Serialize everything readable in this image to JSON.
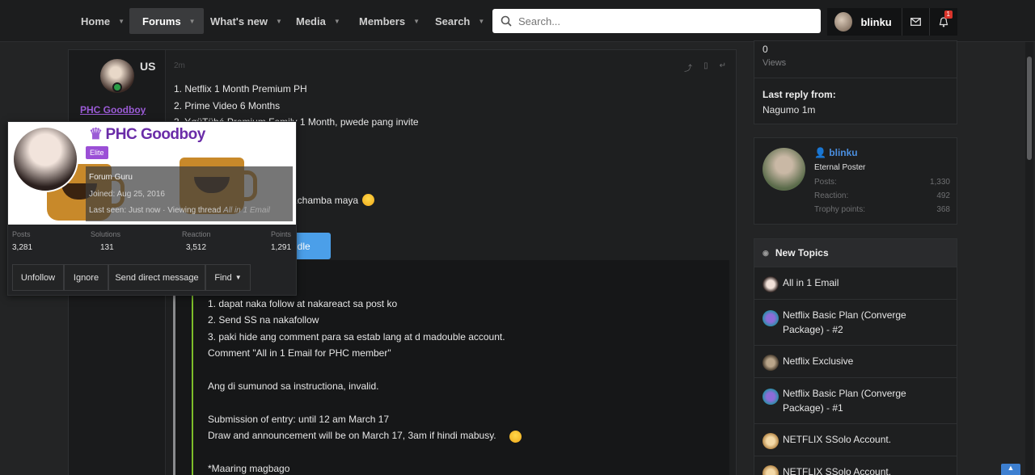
{
  "nav": {
    "items": [
      {
        "label": "Home"
      },
      {
        "label": "Forums"
      },
      {
        "label": "What's new"
      },
      {
        "label": "Media"
      },
      {
        "label": "Members"
      },
      {
        "label": "Search"
      }
    ],
    "search_placeholder": "Search...",
    "username": "blinku",
    "alert_count": "1"
  },
  "post": {
    "us_label": "US",
    "username": "PHC Goodboy",
    "time": "2m",
    "lines": [
      "1. Netflix 1 Month Premium PH",
      "2. Prime Video 6 Months",
      "3. YøüTübé Premium Family 1 Month, pwede pang invite"
    ],
    "partial_line": "kachamba maya",
    "blue_button": "a idle",
    "quote_text": "1. dapat naka follow at nakareact sa post ko\n2. Send SS na nakafollow\n3. paki hide ang comment para sa estab lang at d madouble account.\nComment \"All in 1 Email for PHC member\"\n\nAng di sumunod sa instructiona, invalid.\n\nSubmission of entry: until 12 am March 17\nDraw and announcement will be on March 17, 3am if hindi mabusy.\n\n*Maaring magbago"
  },
  "hovercard": {
    "name": "PHC Goodboy",
    "badge": "Elite",
    "title": "Forum Guru",
    "joined_label": "Joined:",
    "joined_value": "Aug 25, 2016",
    "last_seen_label": "Last seen:",
    "last_seen_value": "Just now · Viewing thread",
    "last_seen_thread": "All in 1 Email",
    "stats": [
      {
        "label": "Posts",
        "value": "3,281"
      },
      {
        "label": "Solutions",
        "value": "131"
      },
      {
        "label": "Reaction",
        "value": "3,512"
      },
      {
        "label": "Points",
        "value": "1,291"
      }
    ],
    "buttons": [
      "Unfollow",
      "Ignore",
      "Send direct message",
      "Find"
    ]
  },
  "sidebar": {
    "views_value": "0",
    "views_label": "Views",
    "last_reply_label": "Last reply from:",
    "last_reply_value": "Nagumo 1m",
    "user": {
      "name": "blinku",
      "rank": "Eternal Poster",
      "rows": [
        {
          "label": "Posts:",
          "value": "1,330"
        },
        {
          "label": "Reaction:",
          "value": "492"
        },
        {
          "label": "Trophy points:",
          "value": "368"
        }
      ]
    },
    "new_topics_title": "New Topics",
    "topics": [
      "All in 1 Email",
      "Netflix Basic Plan (Converge Package) - #2",
      "Netflix Exclusive",
      "Netflix Basic Plan (Converge Package) - #1",
      "NETFLIX SSolo Account.",
      "NETFLIX SSolo Account."
    ]
  },
  "colors": {
    "accent": "#4b9fe9",
    "elite": "#9b4fd6",
    "username_purple": "#6a2ca8",
    "online": "#2a9d46",
    "quote_bar": "#7dbe2a"
  }
}
